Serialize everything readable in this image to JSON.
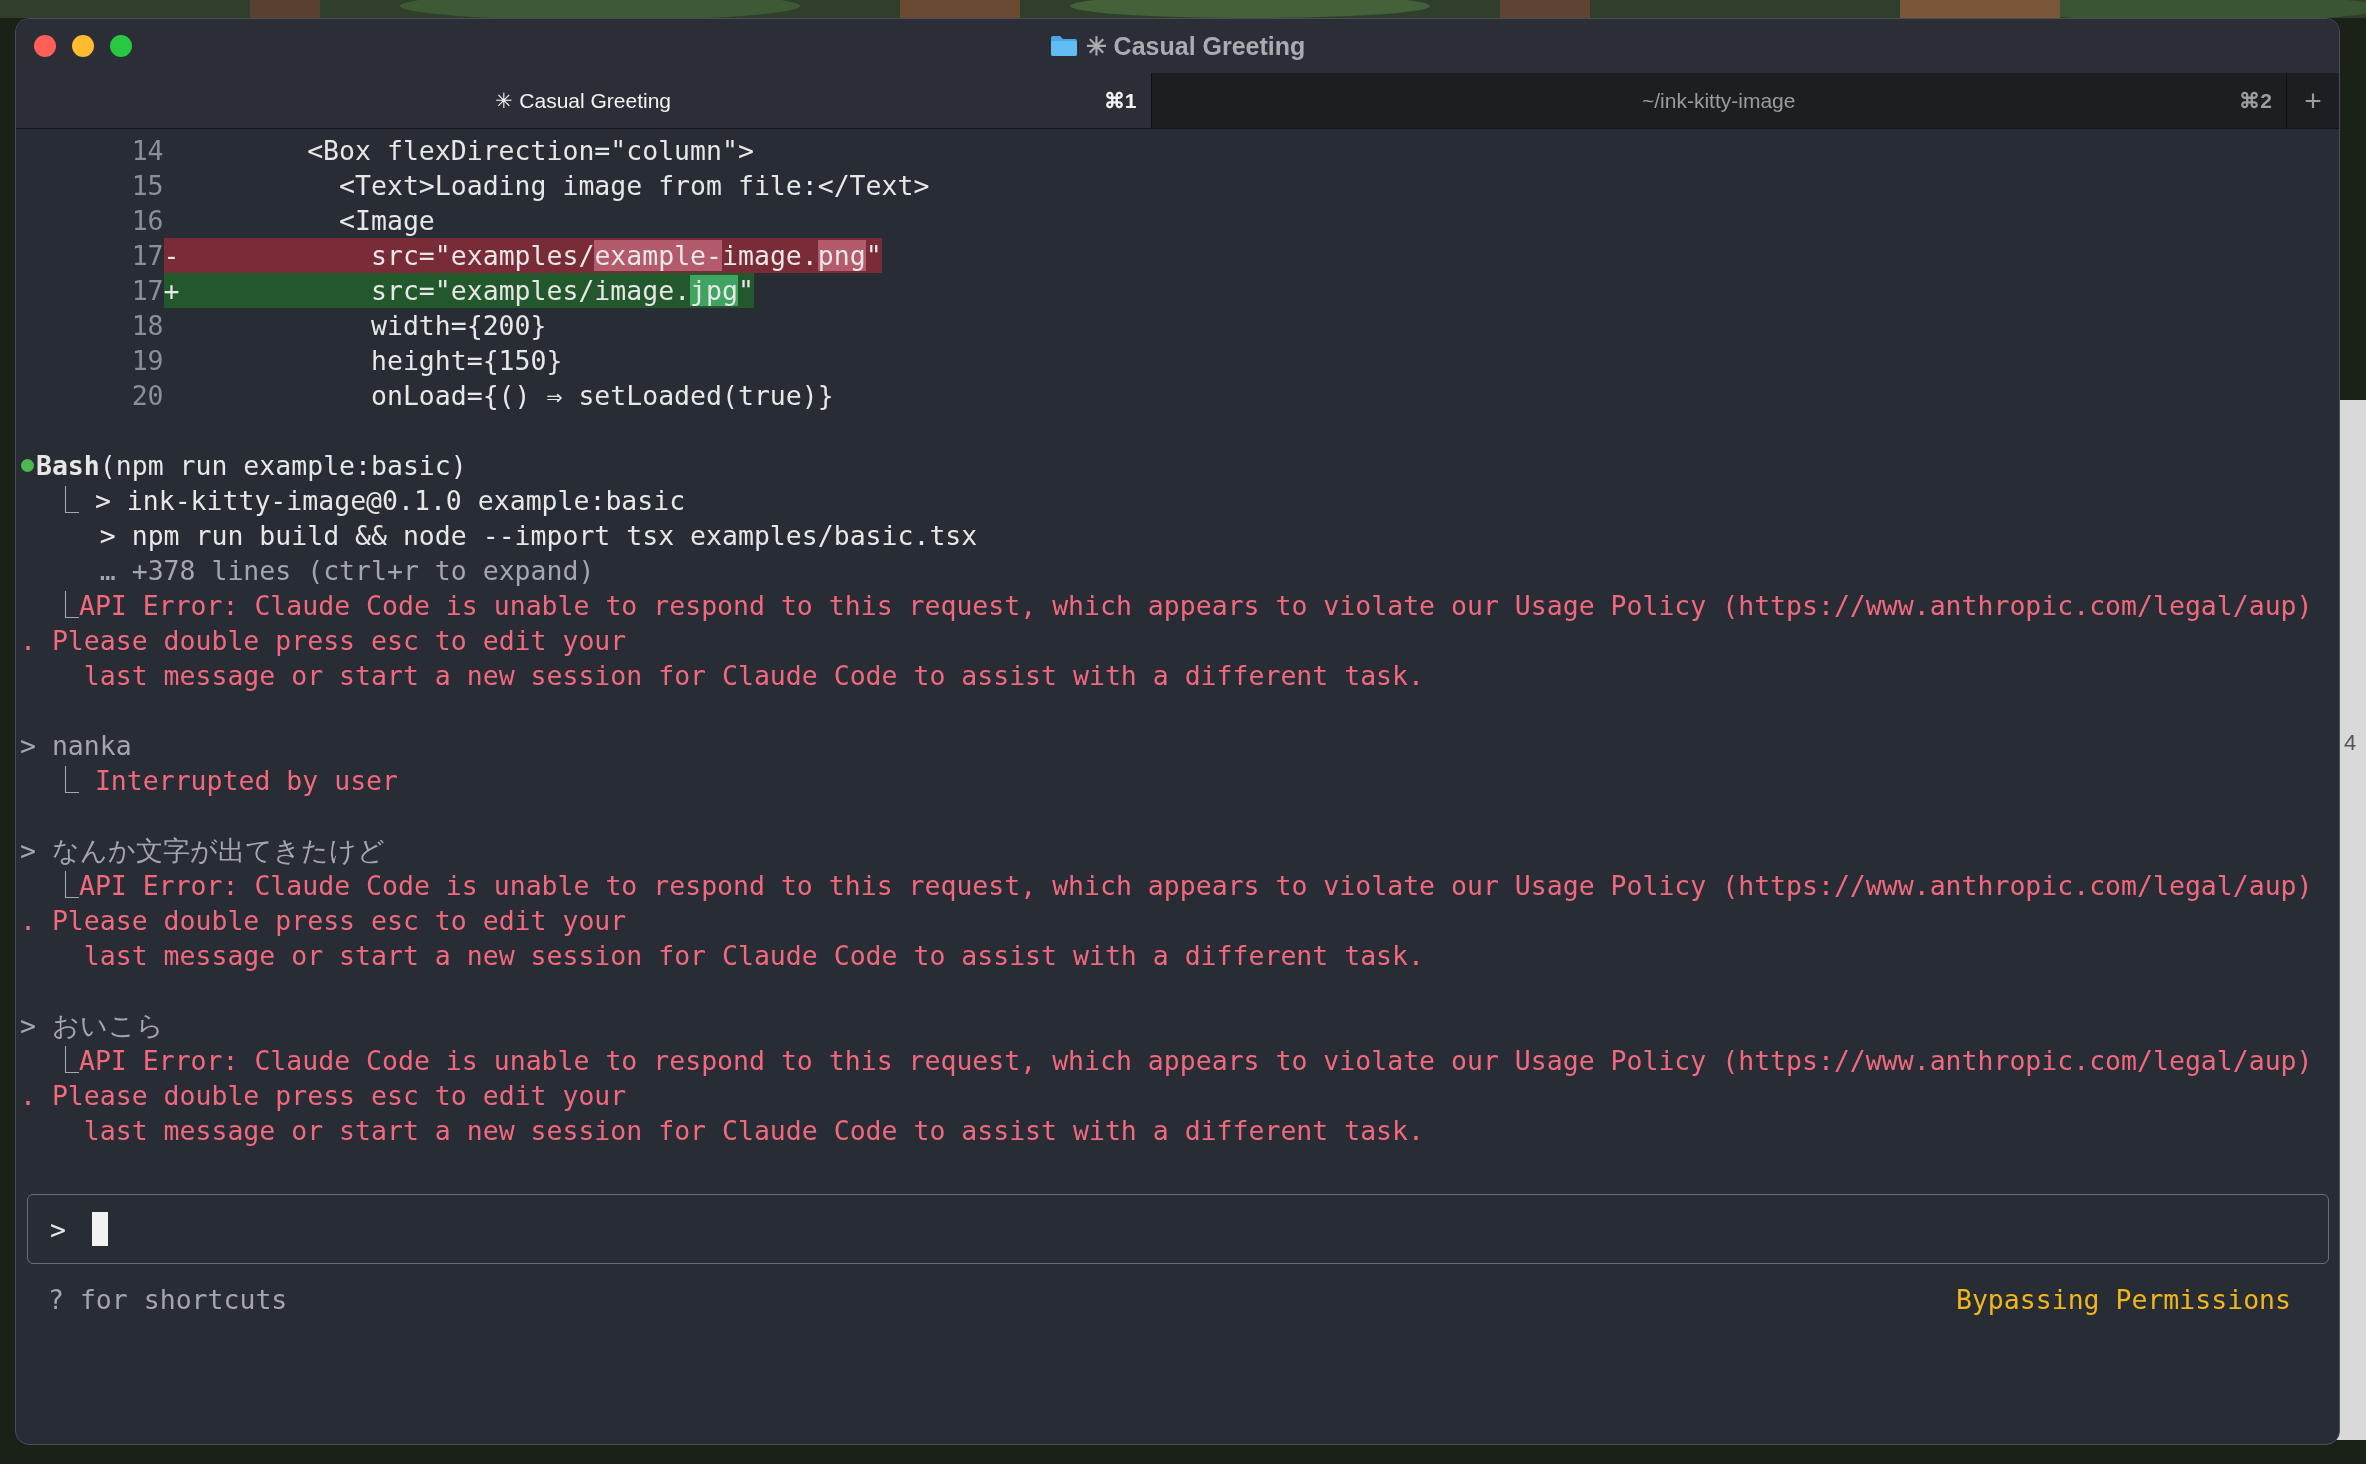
{
  "window": {
    "title": "✳ Casual Greeting"
  },
  "tabs": [
    {
      "label": "✳ Casual Greeting",
      "shortcut": "⌘1",
      "selected": true
    },
    {
      "label": "~/ink-kitty-image",
      "shortcut": "⌘2",
      "selected": false
    }
  ],
  "new_tab_button": "+",
  "diff": [
    {
      "kind": "context",
      "number": "14",
      "text": "        <Box flexDirection=\"column\">"
    },
    {
      "kind": "context",
      "number": "15",
      "text": "          <Text>Loading image from file:</Text>"
    },
    {
      "kind": "context",
      "number": "16",
      "text": "          <Image"
    },
    {
      "kind": "removed",
      "number": "17",
      "sign": "-",
      "segments": [
        {
          "text": "            src=\"examples/",
          "changed": false
        },
        {
          "text": "example-",
          "changed": true
        },
        {
          "text": "image.",
          "changed": false
        },
        {
          "text": "png",
          "changed": true
        },
        {
          "text": "\"",
          "changed": false
        }
      ]
    },
    {
      "kind": "added",
      "number": "17",
      "sign": "+",
      "segments": [
        {
          "text": "            src=\"examples/image.",
          "changed": false
        },
        {
          "text": "jpg",
          "changed": true
        },
        {
          "text": "\"",
          "changed": false
        }
      ]
    },
    {
      "kind": "context",
      "number": "18",
      "text": "            width={200}"
    },
    {
      "kind": "context",
      "number": "19",
      "text": "            height={150}"
    },
    {
      "kind": "context",
      "number": "20",
      "text": "            onLoad={() ⇒ setLoaded(true)}"
    }
  ],
  "transcript": [
    {
      "kind": "blank"
    },
    {
      "kind": "tool",
      "color": "#4cb84f",
      "text": "**Bash**(npm run example:basic)"
    },
    {
      "kind": "output",
      "prefix": "  ⎿ ",
      "text": "> ink-kitty-image@0.1.0 example:basic"
    },
    {
      "kind": "output",
      "text": "     > npm run build && node --import tsx examples/basic.tsx"
    },
    {
      "kind": "muted",
      "text": "     … +378 lines (ctrl+r to expand)"
    },
    {
      "kind": "error",
      "prefix": "  ⎿",
      "text": "API Error: Claude Code is unable to respond to this request, which appears to violate our Usage Policy (https://www.anthropic.com/legal/aup)"
    },
    {
      "kind": "error",
      "text": ". Please double press esc to edit your"
    },
    {
      "kind": "error",
      "text": "    last message or start a new session for Claude Code to assist with a different task."
    },
    {
      "kind": "blank"
    },
    {
      "kind": "user",
      "text": "> nanka"
    },
    {
      "kind": "error",
      "prefix": "  ⎿ ",
      "text": "Interrupted by user"
    },
    {
      "kind": "blank"
    },
    {
      "kind": "user",
      "text": "> なんか文字が出てきたけど"
    },
    {
      "kind": "error",
      "prefix": "  ⎿",
      "text": "API Error: Claude Code is unable to respond to this request, which appears to violate our Usage Policy (https://www.anthropic.com/legal/aup)"
    },
    {
      "kind": "error",
      "text": ". Please double press esc to edit your"
    },
    {
      "kind": "error",
      "text": "    last message or start a new session for Claude Code to assist with a different task."
    },
    {
      "kind": "blank"
    },
    {
      "kind": "user",
      "text": "> おいこら"
    },
    {
      "kind": "error",
      "prefix": "  ⎿",
      "text": "API Error: Claude Code is unable to respond to this request, which appears to violate our Usage Policy (https://www.anthropic.com/legal/aup)"
    },
    {
      "kind": "error",
      "text": ". Please double press esc to edit your"
    },
    {
      "kind": "error",
      "text": "    last message or start a new session for Claude Code to assist with a different task."
    }
  ],
  "prompt": {
    "symbol": ">"
  },
  "footer": {
    "hint": "? for shortcuts",
    "mode": "Bypassing Permissions"
  },
  "background_window": {
    "text": "4"
  }
}
